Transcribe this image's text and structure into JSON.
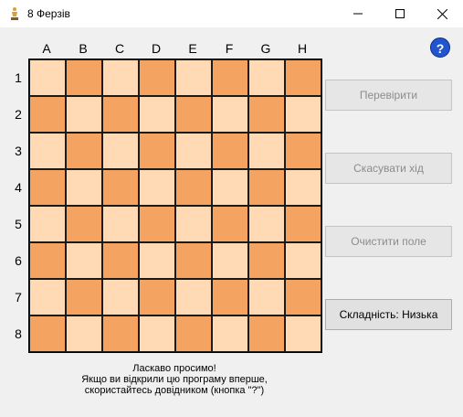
{
  "window": {
    "title": "8 Ферзів",
    "icons": {
      "app": "queen-icon",
      "minimize": "minimize-icon",
      "maximize": "maximize-icon",
      "close": "close-icon"
    }
  },
  "board": {
    "columns": [
      "A",
      "B",
      "C",
      "D",
      "E",
      "F",
      "G",
      "H"
    ],
    "rows": [
      "1",
      "2",
      "3",
      "4",
      "5",
      "6",
      "7",
      "8"
    ],
    "colors": {
      "light": "#ffdab4",
      "dark": "#f4a460"
    }
  },
  "help": {
    "label": "?"
  },
  "buttons": {
    "check": "Перевірити",
    "undo": "Скасувати хід",
    "clear": "Очистити поле",
    "difficulty": "Складність: Низька"
  },
  "welcome": {
    "line1": "Ласкаво просимо!",
    "line2": "Якщо ви відкрили цю програму вперше,",
    "line3": "скористайтесь довідником (кнопка \"?\")"
  }
}
